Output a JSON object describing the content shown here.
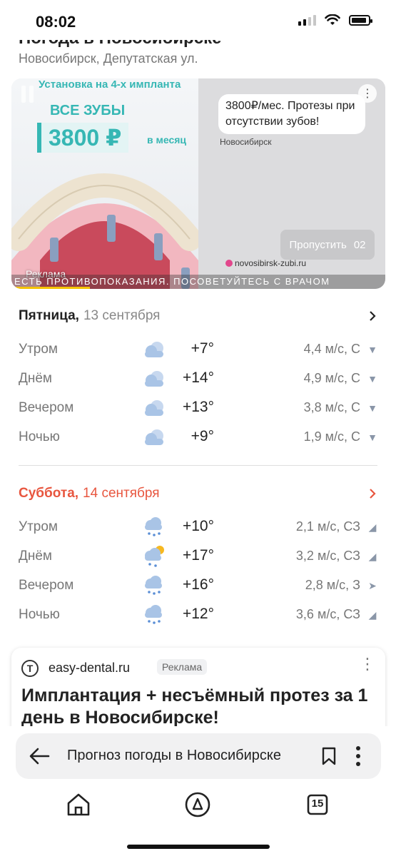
{
  "status_bar": {
    "time": "08:02"
  },
  "header": {
    "title": "Погода в Новосибирске",
    "location": "Новосибирск, Депутатская ул."
  },
  "top_ad": {
    "left_heading": "Установка на 4-х импланта",
    "left_subheading": "ВСЕ ЗУБЫ",
    "price": "3800 ₽",
    "per": "в месяц",
    "bubble_text": "3800₽/мес. Протезы при отсутствии зубов!",
    "city": "Новосибирск",
    "skip_label": "Пропустить",
    "skip_count": "02",
    "domain": "novosibirsk-zubi.ru",
    "ad_label": "Реклама",
    "disclaimer": "ЕСТЬ ПРОТИВОПОКАЗАНИЯ. ПОСОВЕТУЙТЕСЬ С ВРАЧОМ"
  },
  "days": [
    {
      "name": "Пятница,",
      "date": "13 сентября",
      "rows": [
        {
          "period": "Утром",
          "temp": "+7°",
          "wind": "4,4 м/с, С",
          "icon": "cloud-icon"
        },
        {
          "period": "Днём",
          "temp": "+14°",
          "wind": "4,9 м/с, С",
          "icon": "cloud-icon"
        },
        {
          "period": "Вечером",
          "temp": "+13°",
          "wind": "3,8 м/с, С",
          "icon": "cloud-icon"
        },
        {
          "period": "Ночью",
          "temp": "+9°",
          "wind": "1,9 м/с, С",
          "icon": "cloud-icon"
        }
      ]
    },
    {
      "name": "Суббота,",
      "date": "14 сентября",
      "rows": [
        {
          "period": "Утром",
          "temp": "+10°",
          "wind": "2,1 м/с, СЗ",
          "icon": "rain-cloud-icon"
        },
        {
          "period": "Днём",
          "temp": "+17°",
          "wind": "3,2 м/с, СЗ",
          "icon": "sun-rain-cloud-icon"
        },
        {
          "period": "Вечером",
          "temp": "+16°",
          "wind": "2,8 м/с, З",
          "icon": "rain-cloud-icon"
        },
        {
          "period": "Ночью",
          "temp": "+12°",
          "wind": "3,6 м/с, СЗ",
          "icon": "rain-cloud-icon"
        }
      ]
    }
  ],
  "ad_card": {
    "site": "easy-dental.ru",
    "badge": "Реклама",
    "headline": "Имплантация + несъёмный протез за 1 день в Новосибирске!"
  },
  "url_bar": {
    "title": "Прогноз погоды в Новосибирске"
  },
  "tabs_count": "15",
  "colors": {
    "accent_red": "#e8563f",
    "ad_teal": "#36b7b4",
    "cloud": "#a9c4e6"
  }
}
